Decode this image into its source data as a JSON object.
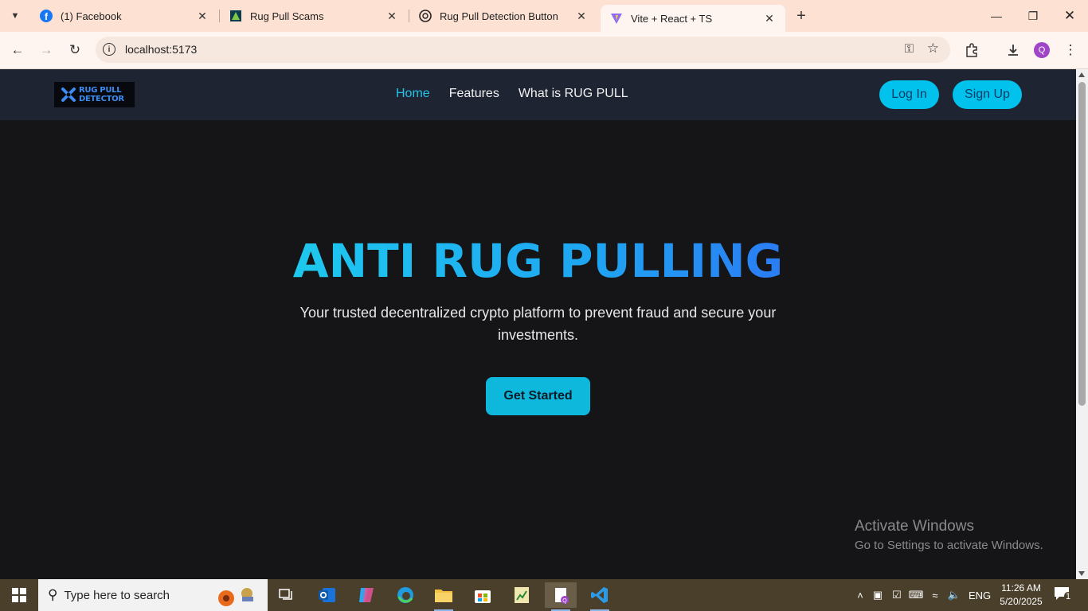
{
  "browser": {
    "tabs": [
      {
        "title": "(1) Facebook",
        "icon": "facebook-icon",
        "active": false
      },
      {
        "title": "Rug Pull Scams",
        "icon": "site-icon",
        "active": false
      },
      {
        "title": "Rug Pull Detection Button",
        "icon": "chatgpt-icon",
        "active": false
      },
      {
        "title": "Vite + React + TS",
        "icon": "vite-icon",
        "active": true
      }
    ],
    "url": "localhost:5173",
    "profile_initial": "Q"
  },
  "page": {
    "logo": {
      "line1": "RUG PULL",
      "line2": "DETECTOR"
    },
    "nav": [
      {
        "label": "Home",
        "active": true
      },
      {
        "label": "Features",
        "active": false
      },
      {
        "label": "What is RUG PULL",
        "active": false
      }
    ],
    "auth": {
      "login": "Log In",
      "signup": "Sign Up"
    },
    "hero": {
      "title": "ANTI RUG PULLING",
      "subtitle": "Your trusted decentralized crypto platform to prevent fraud and secure your investments.",
      "cta": "Get Started"
    },
    "colors": {
      "accent": "#00c2ec",
      "nav_bg": "#1f2433",
      "page_bg": "#151518"
    }
  },
  "watermark": {
    "line1": "Activate Windows",
    "line2": "Go to Settings to activate Windows."
  },
  "taskbar": {
    "search_placeholder": "Type here to search",
    "language": "ENG",
    "time": "11:26 AM",
    "date": "5/20/2025",
    "notification_count": "1"
  }
}
